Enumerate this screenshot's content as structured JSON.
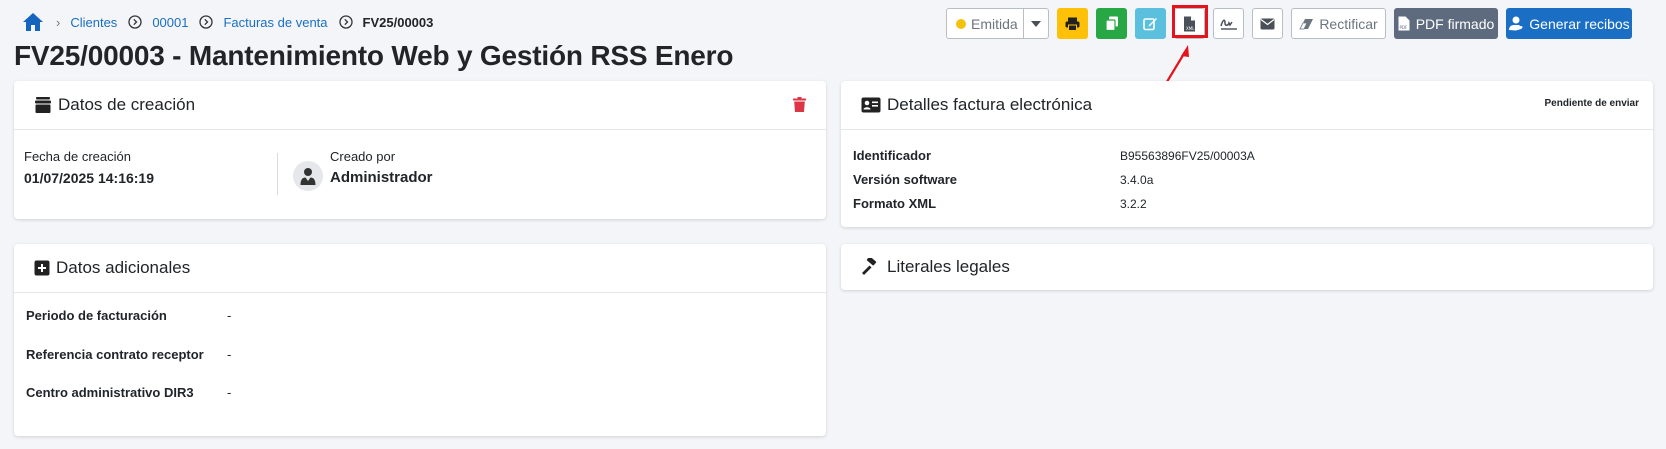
{
  "breadcrumb": {
    "items": [
      "Clientes",
      "00001",
      "Facturas de venta"
    ],
    "current": "FV25/00003"
  },
  "title": "FV25/00003 - Mantenimiento Web y Gestión RSS Enero",
  "toolbar": {
    "status_label": "Emitida",
    "status_color": "#f4c20d",
    "rectify_label": "Rectificar",
    "signed_pdf_label": "PDF firmado",
    "receipts_label": "Generar recibos",
    "icons": [
      "print-icon",
      "copy-icon",
      "edit-icon",
      "xml-file-icon",
      "signature-icon",
      "envelope-icon",
      "eraser-icon",
      "pdf-file-icon",
      "user-hand-icon"
    ]
  },
  "creation": {
    "title": "Datos de creación",
    "date_label": "Fecha de creación",
    "date_value": "01/07/2025 14:16:19",
    "creator_label": "Creado por",
    "creator_value": "Administrador"
  },
  "extra": {
    "title": "Datos adicionales",
    "rows": [
      {
        "label": "Periodo de facturación",
        "value": "-"
      },
      {
        "label": "Referencia contrato receptor",
        "value": "-"
      },
      {
        "label": "Centro administrativo DIR3",
        "value": "-"
      }
    ]
  },
  "einvoice": {
    "title": "Detalles factura electrónica",
    "status": "Pendiente de enviar",
    "rows": [
      {
        "label": "Identificador",
        "value": "B95563896FV25/00003A"
      },
      {
        "label": "Versión software",
        "value": "3.4.0a"
      },
      {
        "label": "Formato XML",
        "value": "3.2.2"
      }
    ]
  },
  "legal": {
    "title": "Literales legales"
  },
  "colors": {
    "accent": "#1a6fc4",
    "highlight": "#e3141b"
  }
}
